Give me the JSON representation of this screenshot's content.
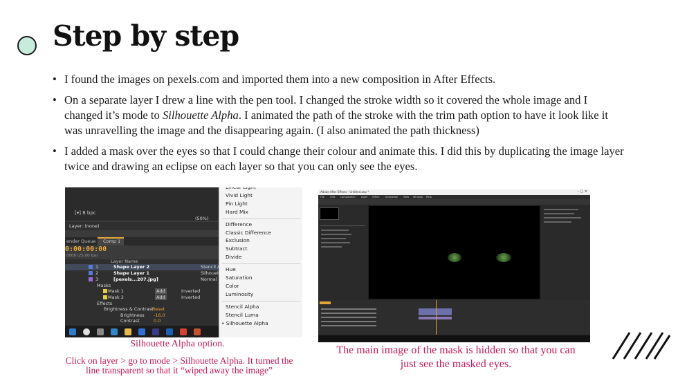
{
  "slide": {
    "title": "Step by step",
    "bullets": [
      {
        "text": "I found the images on pexels.com and imported them into a new composition in After Effects."
      },
      {
        "before": "On a separate layer I drew a line with the pen tool. I changed the stroke width so it covered the whole image and I changed it’s mode to ",
        "italic": "Silhouette Alpha",
        "after": ". I animated the path of the stroke with the trim path option to have it look like it was unravelling the image and the disappearing again. (I also animated the path thickness)"
      },
      {
        "text": "I added a mask over the eyes so that I could change their colour and animate this. I did this by duplicating the image layer twice and drawing an eclipse on each layer so that you can only see the eyes."
      }
    ]
  },
  "left_screenshot": {
    "bpc_label": "8 bpc",
    "zoom_label": "(50%)",
    "layer_label": "Layer: (none)",
    "render_queue_tab": "ender Queue",
    "comp_tab": "Comp 1",
    "timecode": "0:00:00:00",
    "fps": "0000 (25.00 fps)",
    "layer_name_header": "Layer Name",
    "layers": [
      {
        "num": "1",
        "name": "Shape Layer 2",
        "mode": "Stencil A"
      },
      {
        "num": "2",
        "name": "Shape Layer 1",
        "mode": "Silhouet"
      },
      {
        "num": "3",
        "name": "[pexels...207.jpg]",
        "mode": "Normal"
      }
    ],
    "masks_label": "Masks",
    "masks": [
      {
        "name": "Mask 1",
        "mode": "Add",
        "inv": "Inverted"
      },
      {
        "name": "Mask 2",
        "mode": "Add",
        "inv": "Inverted"
      }
    ],
    "effects_label": "Effects",
    "effect_name": "Brightness & Contrast",
    "effect_reset": "Reset",
    "brightness_label": "Brightness",
    "brightness_value": "-16.0",
    "contrast_label": "Contrast",
    "contrast_value": "0.0",
    "mode_menu": [
      {
        "label": "Linear Light",
        "type": "item"
      },
      {
        "label": "Vivid Light",
        "type": "item"
      },
      {
        "label": "Pin Light",
        "type": "item"
      },
      {
        "label": "Hard Mix",
        "type": "item"
      },
      {
        "type": "sep"
      },
      {
        "label": "Difference",
        "type": "item"
      },
      {
        "label": "Classic Difference",
        "type": "item"
      },
      {
        "label": "Exclusion",
        "type": "item"
      },
      {
        "label": "Subtract",
        "type": "item"
      },
      {
        "label": "Divide",
        "type": "item"
      },
      {
        "type": "sep"
      },
      {
        "label": "Hue",
        "type": "item"
      },
      {
        "label": "Saturation",
        "type": "item"
      },
      {
        "label": "Color",
        "type": "item"
      },
      {
        "label": "Luminosity",
        "type": "item"
      },
      {
        "type": "sep"
      },
      {
        "label": "Stencil Alpha",
        "type": "item"
      },
      {
        "label": "Stencil Luma",
        "type": "item"
      },
      {
        "label": "Silhouette Alpha",
        "type": "selected"
      }
    ]
  },
  "right_screenshot": {
    "window_title": "Adobe After Effects - Untitled.aep *",
    "menu_items": [
      "File",
      "Edit",
      "Composition",
      "Layer",
      "Effect",
      "Animation",
      "View",
      "Window",
      "Help"
    ],
    "eye_color": "#3f6a32"
  },
  "captions": {
    "left_line1": "Silhouette Alpha option.",
    "left_line2": "Click on layer > go to mode > Silhouette Alpha. It turned the line transparent so that it “wiped away the image”",
    "right": "The main image of the mask is hidden so that you can just see the masked eyes."
  },
  "colors": {
    "accent_circle": "#c8ecdc",
    "caption": "#c2185b",
    "ae_orange": "#e6a73a"
  }
}
